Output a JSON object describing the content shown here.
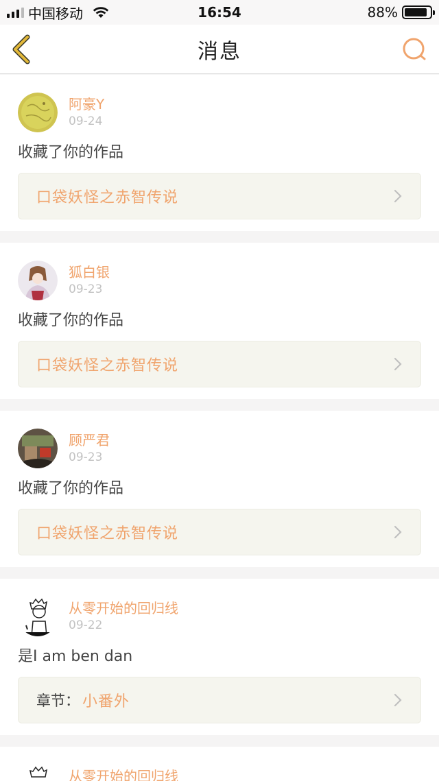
{
  "status_bar": {
    "carrier": "中国移动",
    "time": "16:54",
    "battery": "88%",
    "battery_level": 0.88
  },
  "nav": {
    "title": "消息",
    "back_icon": "back-chevron-icon",
    "search_icon": "search-icon"
  },
  "messages": [
    {
      "username": "阿豪Y",
      "date": "09-24",
      "action": "收藏了你的作品",
      "link_prefix": "",
      "link": "口袋妖怪之赤智传说",
      "avatar_color": "#c9c24a"
    },
    {
      "username": "狐白银",
      "date": "09-23",
      "action": "收藏了你的作品",
      "link_prefix": "",
      "link": "口袋妖怪之赤智传说",
      "avatar_color": "#c9a6b8"
    },
    {
      "username": "顾严君",
      "date": "09-23",
      "action": "收藏了你的作品",
      "link_prefix": "",
      "link": "口袋妖怪之赤智传说",
      "avatar_color": "#6a5a48"
    },
    {
      "username": "从零开始的回归线",
      "date": "09-22",
      "action": "是I am ben dan",
      "link_prefix": "章节：",
      "link": "小番外",
      "avatar_color": "#ffffff"
    },
    {
      "username": "从零开始的回归线"
    }
  ],
  "colors": {
    "accent": "#f0a46d",
    "date": "#c2c2c2",
    "link_bg": "#f5f5ee",
    "back_icon": "#e3b93a"
  }
}
